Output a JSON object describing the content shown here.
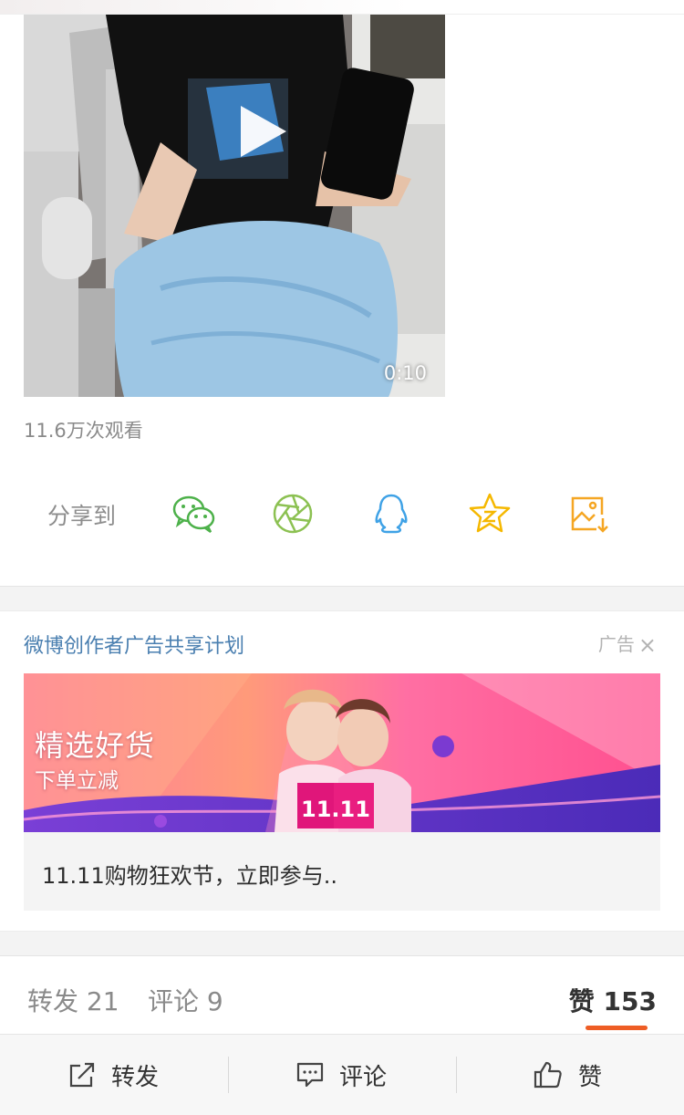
{
  "video": {
    "duration": "0:10",
    "views": "11.6万次观看"
  },
  "share": {
    "label": "分享到",
    "targets": [
      {
        "icon": "wechat-icon",
        "color": "#4db14a"
      },
      {
        "icon": "moments-icon",
        "color": "#8cc152"
      },
      {
        "icon": "qq-icon",
        "color": "#3fa2e6"
      },
      {
        "icon": "qzone-icon",
        "color": "#f5b800"
      },
      {
        "icon": "save-image-icon",
        "color": "#f5a623"
      }
    ]
  },
  "ad": {
    "header": "微博创作者广告共享计划",
    "tag": "广告",
    "close": "×",
    "banner_title": "精选好货",
    "banner_subtitle": "下单立减",
    "banner_badge": "11.11",
    "caption": "11.11购物狂欢节，立即参与.."
  },
  "stats": {
    "reposts": "转发 21",
    "comments": "评论 9",
    "likes": "赞 153",
    "accent": "#ee5d25"
  },
  "actions": {
    "repost": "转发",
    "comment": "评论",
    "like": "赞"
  }
}
